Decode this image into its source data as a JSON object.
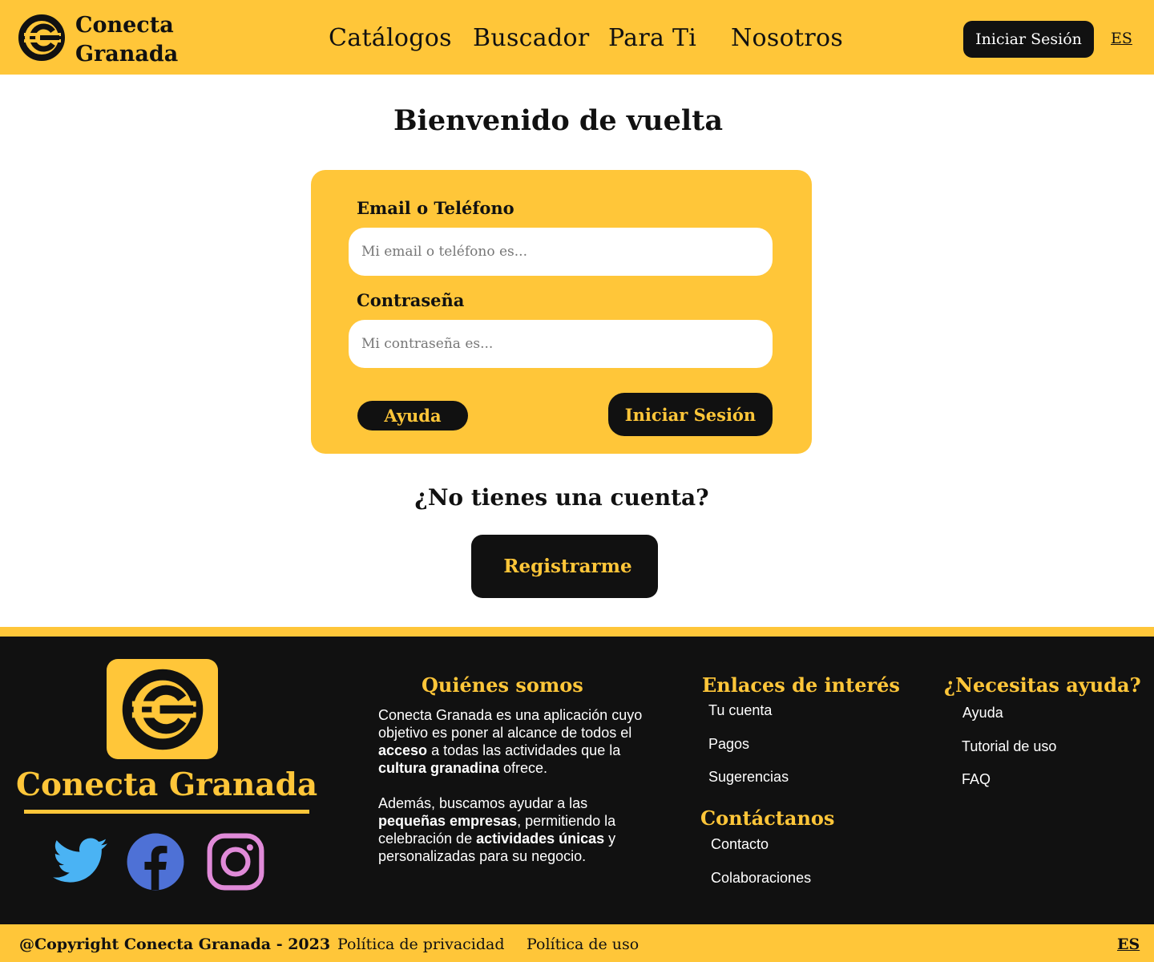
{
  "header": {
    "brand_line1": "Conecta",
    "brand_line2": "Granada",
    "nav": [
      "Catálogos",
      "Buscador",
      "Para Ti",
      "Nosotros"
    ],
    "login_label": "Iniciar Sesión",
    "language": "ES"
  },
  "main": {
    "title": "Bienvenido de vuelta",
    "email_label": "Email o Teléfono",
    "email_placeholder": "Mi email o teléfono es...",
    "password_label": "Contraseña",
    "password_placeholder": "Mi contraseña es...",
    "help_label": "Ayuda",
    "submit_label": "Iniciar Sesión",
    "no_account": "¿No tienes una cuenta?",
    "register_label": "Registrarme"
  },
  "footer": {
    "brand": "Conecta Granada",
    "about_heading": "Quiénes somos",
    "about_p1": [
      "Conecta Granada es una aplicación cuyo objetivo es poner al alcance de todos el ",
      "acceso",
      " a todas las actividades que la ",
      "cultura granadina",
      " ofrece."
    ],
    "about_p2": [
      "Además, buscamos ayudar a las ",
      "pequeñas empresas",
      ", permitiendo la celebración de ",
      "actividades únicas",
      " y personalizadas para su negocio."
    ],
    "links_heading": "Enlaces de interés",
    "links": [
      "Tu cuenta",
      "Pagos",
      "Sugerencias"
    ],
    "contact_heading": "Contáctanos",
    "contact_links": [
      "Contacto",
      "Colaboraciones"
    ],
    "help_heading": "¿Necesitas ayuda?",
    "help_links": [
      "Ayuda",
      "Tutorial de uso",
      "FAQ"
    ],
    "social": [
      "twitter-icon",
      "facebook-icon",
      "instagram-icon"
    ]
  },
  "bottom_bar": {
    "copyright": "@Copyright Conecta Granada - 2023",
    "privacy": "Política de privacidad",
    "usage": "Política de uso",
    "language": "ES"
  },
  "colors": {
    "accent": "#ffc639",
    "dark": "#111111",
    "twitter": "#4ab3f4",
    "facebook": "#4e71d6",
    "instagram": "#e08ad8"
  }
}
